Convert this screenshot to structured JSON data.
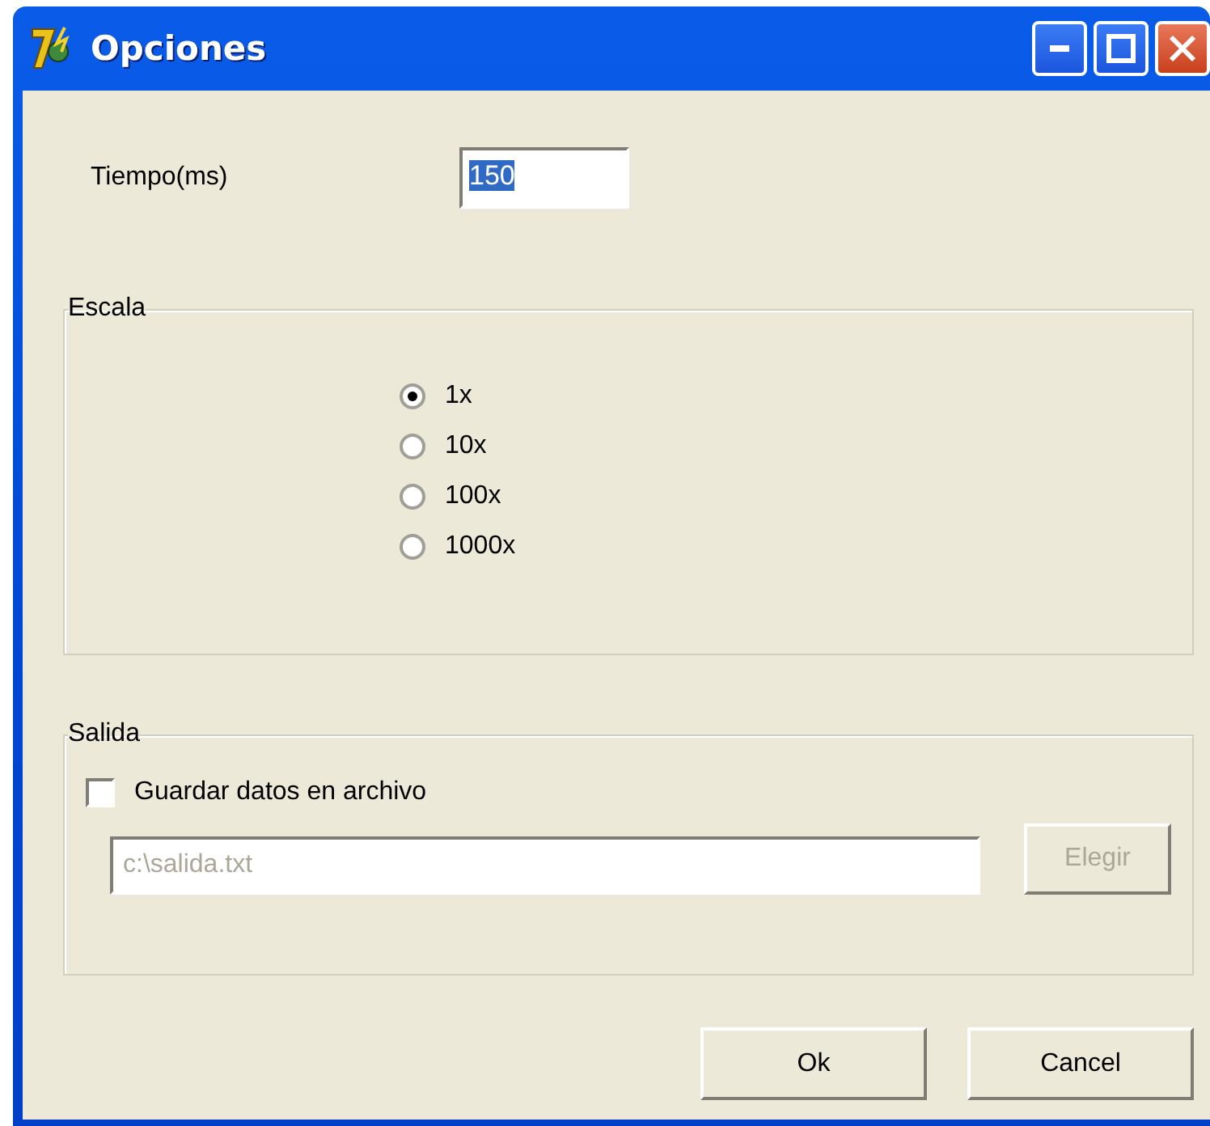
{
  "window": {
    "title": "Opciones"
  },
  "tiempo": {
    "label": "Tiempo(ms)",
    "value": "150",
    "selected": true
  },
  "escala": {
    "title": "Escala",
    "options": [
      {
        "label": "1x",
        "selected": true
      },
      {
        "label": "10x",
        "selected": false
      },
      {
        "label": "100x",
        "selected": false
      },
      {
        "label": "1000x",
        "selected": false
      }
    ]
  },
  "salida": {
    "title": "Salida",
    "checkbox": {
      "label": "Guardar datos en archivo",
      "checked": false
    },
    "path": {
      "value": "c:\\salida.txt",
      "disabled": true
    },
    "choose_button": {
      "label": "Elegir",
      "disabled": true
    }
  },
  "buttons": [
    {
      "label": "Ok"
    },
    {
      "label": "Cancel"
    }
  ]
}
